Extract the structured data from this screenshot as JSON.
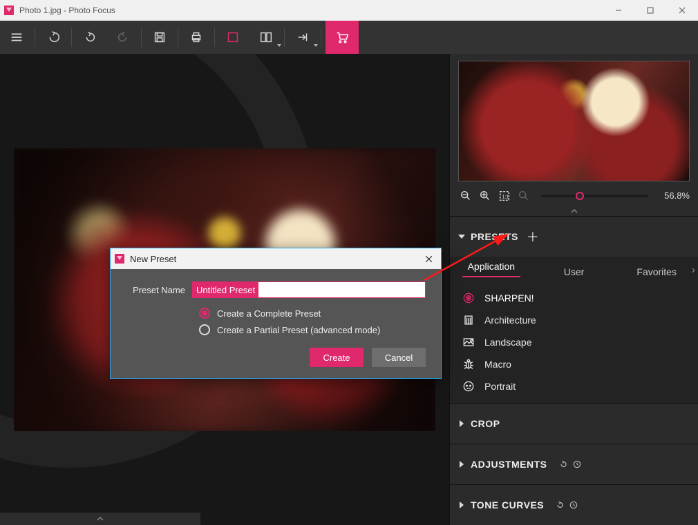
{
  "window": {
    "title": "Photo 1.jpg - Photo Focus"
  },
  "toolbar": {
    "buttons": [
      "menu",
      "undo-big",
      "undo",
      "redo",
      "save",
      "print",
      "frame",
      "compare",
      "share",
      "cart"
    ]
  },
  "zoom": {
    "value": "56.8%"
  },
  "presets": {
    "header": "PRESETS",
    "tabs": {
      "application": "Application",
      "user": "User",
      "favorites": "Favorites"
    },
    "active_tab": "application",
    "items": [
      {
        "label": "SHARPEN!",
        "icon": "target",
        "selected": true
      },
      {
        "label": "Architecture",
        "icon": "building",
        "selected": false
      },
      {
        "label": "Landscape",
        "icon": "landscape",
        "selected": false
      },
      {
        "label": "Macro",
        "icon": "bug",
        "selected": false
      },
      {
        "label": "Portrait",
        "icon": "face",
        "selected": false
      }
    ]
  },
  "sections": {
    "crop": "CROP",
    "adjustments": "ADJUSTMENTS",
    "tone_curves": "TONE CURVES"
  },
  "dialog": {
    "title": "New Preset",
    "name_label": "Preset Name",
    "name_value": "Untitled Preset",
    "opt_complete": "Create a Complete Preset",
    "opt_partial": "Create a Partial Preset (advanced mode)",
    "create": "Create",
    "cancel": "Cancel"
  }
}
